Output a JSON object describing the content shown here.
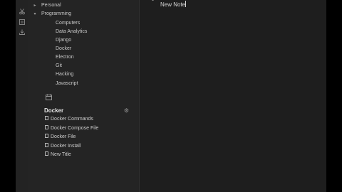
{
  "sidebar": {
    "tree": [
      {
        "label": "Personal",
        "expanded": false
      },
      {
        "label": "Programming",
        "expanded": true
      }
    ],
    "programming_children": [
      "Computers",
      "Data Analytics",
      "Django",
      "Docker",
      "Electron",
      "Git",
      "Hacking",
      "Javascript"
    ]
  },
  "section": {
    "title": "Docker",
    "notes": [
      "Docker Commands",
      "Docker Compose File",
      "Docker File",
      "Docker Install",
      "New Title"
    ]
  },
  "editor": {
    "line": "New Note"
  },
  "colors": {
    "background": "#1e1e1e",
    "sidebar": "#242424",
    "text": "#cfcfcf"
  },
  "icons": [
    "scissors-icon",
    "list-icon",
    "download-icon",
    "calendar-icon",
    "gear-icon",
    "document-icon",
    "chevron-right-icon",
    "chevron-down-icon"
  ]
}
